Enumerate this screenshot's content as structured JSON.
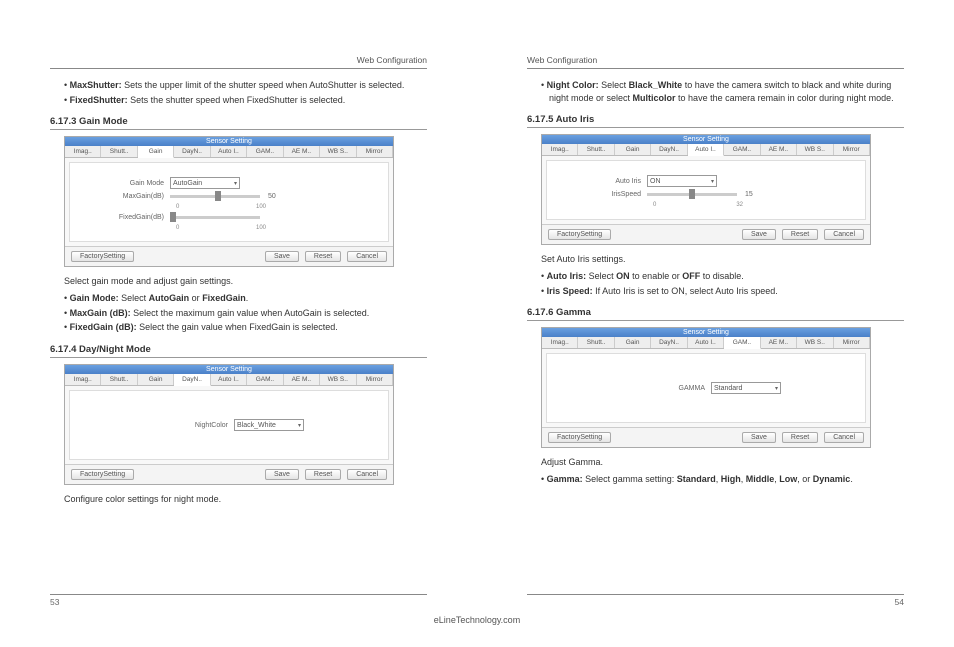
{
  "site": "eLineTechnology.com",
  "header": "Web Configuration",
  "left": {
    "pageNum": "53",
    "bullets_top": [
      {
        "b": "MaxShutter:",
        "t": " Sets the upper limit of the shutter speed when AutoShutter is selected."
      },
      {
        "b": "FixedShutter:",
        "t": " Sets the shutter speed when FixedShutter is selected."
      }
    ],
    "s1": {
      "title": "6.17.3 Gain Mode",
      "caption": "Select gain mode and adjust gain settings.",
      "bullets": [
        {
          "pre": "Gain Mode:",
          "mid": " Select ",
          "b1": "AutoGain",
          "mid2": " or ",
          "b2": "FixedGain",
          "post": "."
        },
        {
          "pre": "MaxGain (dB):",
          "mid": " Select the maximum gain value when AutoGain is selected.",
          "b1": "",
          "mid2": "",
          "b2": "",
          "post": ""
        },
        {
          "pre": "FixedGain (dB):",
          "mid": " Select the gain value when FixedGain is selected.",
          "b1": "",
          "mid2": "",
          "b2": "",
          "post": ""
        }
      ],
      "ss": {
        "title": "Sensor Setting",
        "tabs": [
          "Imag..",
          "Shutt..",
          "Gain",
          "DayN..",
          "Auto I..",
          "GAM..",
          "AE M..",
          "WB S..",
          "Mirror"
        ],
        "active": 2,
        "gainModeLabel": "Gain Mode",
        "gainModeVal": "AutoGain",
        "maxGainLabel": "MaxGain(dB)",
        "maxGainVal": "50",
        "maxGainMin": "0",
        "maxGainMax": "100",
        "fixedGainLabel": "FixedGain(dB)",
        "fixedGainMin": "0",
        "fixedGainMax": "100",
        "btns": {
          "factory": "FactorySetting",
          "save": "Save",
          "reset": "Reset",
          "cancel": "Cancel"
        }
      }
    },
    "s2": {
      "title": "6.17.4 Day/Night Mode",
      "caption": "Configure color settings for night mode.",
      "ss": {
        "title": "Sensor Setting",
        "tabs": [
          "Imag..",
          "Shutt..",
          "Gain",
          "DayN..",
          "Auto I..",
          "GAM..",
          "AE M..",
          "WB S..",
          "Mirror"
        ],
        "active": 3,
        "label": "NightColor",
        "val": "Black_White",
        "btns": {
          "factory": "FactorySetting",
          "save": "Save",
          "reset": "Reset",
          "cancel": "Cancel"
        }
      }
    }
  },
  "right": {
    "pageNum": "54",
    "bullets_top": [
      {
        "pre": "Night Color:",
        "mid": " Select ",
        "b1": "Black_White",
        "mid2": " to have the camera switch to black and white during night mode or select ",
        "b2": "Multicolor",
        "post": " to have the camera remain in color during night mode."
      }
    ],
    "s1": {
      "title": "6.17.5 Auto Iris",
      "caption": "Set Auto Iris settings.",
      "bullets": [
        {
          "pre": "Auto Iris:",
          "mid": " Select ",
          "b1": "ON",
          "mid2": " to enable or ",
          "b2": "OFF",
          "post": " to disable."
        },
        {
          "pre": "Iris Speed:",
          "mid": " If Auto Iris is set to ON, select Auto Iris speed.",
          "b1": "",
          "mid2": "",
          "b2": "",
          "post": ""
        }
      ],
      "ss": {
        "title": "Sensor Setting",
        "tabs": [
          "Imag..",
          "Shutt..",
          "Gain",
          "DayN..",
          "Auto I..",
          "GAM..",
          "AE M..",
          "WB S..",
          "Mirror"
        ],
        "active": 4,
        "autoIrisLabel": "Auto Iris",
        "autoIrisVal": "ON",
        "irisSpeedLabel": "IrisSpeed",
        "irisSpeedVal": "15",
        "irisMin": "0",
        "irisMax": "32",
        "btns": {
          "factory": "FactorySetting",
          "save": "Save",
          "reset": "Reset",
          "cancel": "Cancel"
        }
      }
    },
    "s2": {
      "title": "6.17.6 Gamma",
      "caption": "Adjust Gamma.",
      "bullet": {
        "pre": "Gamma:",
        "mid": " Select gamma setting: ",
        "opts": [
          "Standard",
          "High",
          "Middle",
          "Low",
          "Dynamic"
        ],
        "post": "."
      },
      "ss": {
        "title": "Sensor Setting",
        "tabs": [
          "Imag..",
          "Shutt..",
          "Gain",
          "DayN..",
          "Auto I..",
          "GAM..",
          "AE M..",
          "WB S..",
          "Mirror"
        ],
        "active": 5,
        "label": "GAMMA",
        "val": "Standard",
        "btns": {
          "factory": "FactorySetting",
          "save": "Save",
          "reset": "Reset",
          "cancel": "Cancel"
        }
      }
    }
  }
}
